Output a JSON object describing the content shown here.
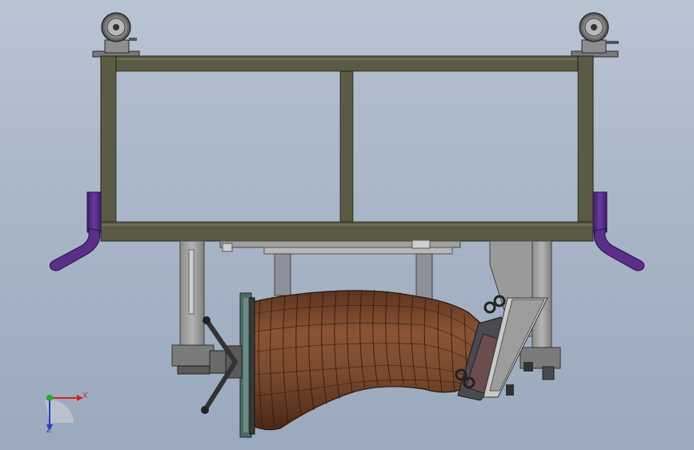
{
  "model": {
    "name": "",
    "components": {
      "caster_wheels": 2,
      "frame_bays": 2
    }
  },
  "triad": {
    "x_label": "X",
    "z_label": "Z",
    "colors": {
      "x": "#d42424",
      "y": "#27a52a",
      "z": "#2a3ac4"
    }
  },
  "colors": {
    "background_top": "#b9c4d3",
    "background_bottom": "#9aa9bd",
    "frame": "#5b5b45",
    "duct": "#7a4a2e",
    "handle": "#5a2f8a",
    "bracket": "#9b9b9b"
  }
}
